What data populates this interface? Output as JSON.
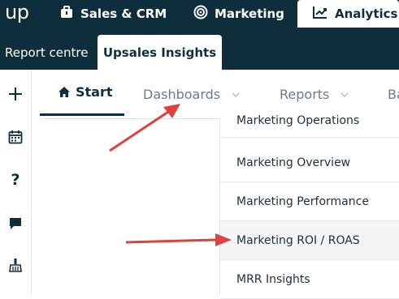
{
  "topnav": {
    "logo": "up",
    "items": [
      {
        "label": "Sales & CRM",
        "icon": "briefcase-icon"
      },
      {
        "label": "Marketing",
        "icon": "target-icon"
      },
      {
        "label": "Analytics",
        "icon": "chart-line-icon",
        "active": true
      }
    ]
  },
  "subnav": {
    "tabs": [
      {
        "label": "Report centre"
      },
      {
        "label": "Upsales Insights",
        "active": true
      }
    ]
  },
  "sidebar": {
    "icons": [
      "plus-icon",
      "calendar-icon",
      "help-icon",
      "chat-icon",
      "broom-icon"
    ]
  },
  "tabs": [
    {
      "label": "Start",
      "icon": "home-icon",
      "active": true
    },
    {
      "label": "Dashboards",
      "has_dropdown": true
    },
    {
      "label": "Reports",
      "has_dropdown": true
    },
    {
      "label": "Ba"
    }
  ],
  "dropdown": {
    "items": [
      "Marketing Operations",
      "Marketing Overview",
      "Marketing Performance",
      "Marketing ROI / ROAS",
      "MRR Insights"
    ],
    "highlighted_index": 3
  },
  "colors": {
    "nav_bg": "#0e2e3c",
    "arrow": "#e04040",
    "text": "#1e2e3a",
    "muted": "#6b7b89"
  }
}
